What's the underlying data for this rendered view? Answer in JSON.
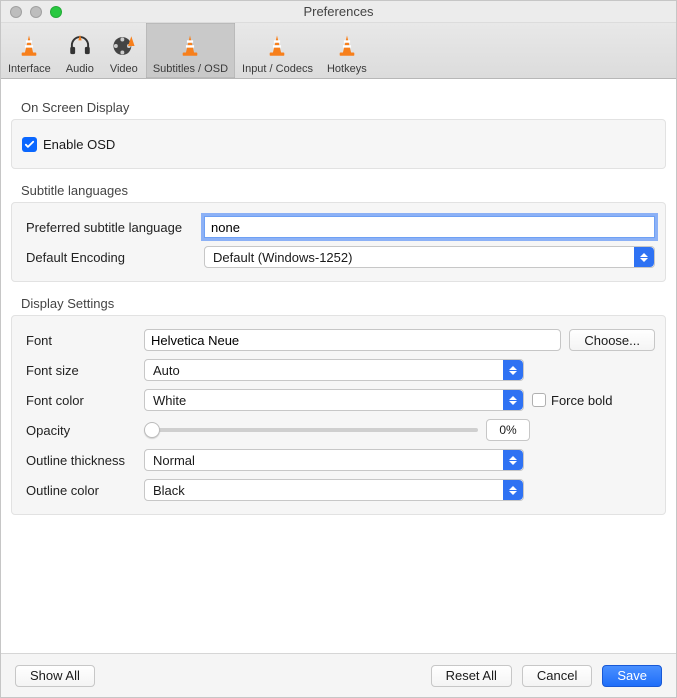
{
  "window": {
    "title": "Preferences"
  },
  "tabs": {
    "interface": "Interface",
    "audio": "Audio",
    "video": "Video",
    "subtitles": "Subtitles / OSD",
    "input": "Input / Codecs",
    "hotkeys": "Hotkeys",
    "active": "subtitles"
  },
  "sections": {
    "osd": {
      "title": "On Screen Display",
      "enable_label": "Enable OSD",
      "enable_checked": true
    },
    "lang": {
      "title": "Subtitle languages",
      "pref_label": "Preferred subtitle language",
      "pref_value": "none",
      "enc_label": "Default Encoding",
      "enc_value": "Default (Windows-1252)"
    },
    "display": {
      "title": "Display Settings",
      "font_label": "Font",
      "font_value": "Helvetica Neue",
      "choose_label": "Choose...",
      "size_label": "Font size",
      "size_value": "Auto",
      "color_label": "Font color",
      "color_value": "White",
      "forcebold_label": "Force bold",
      "forcebold_checked": false,
      "opacity_label": "Opacity",
      "opacity_value": "0%",
      "outline_thick_label": "Outline thickness",
      "outline_thick_value": "Normal",
      "outline_color_label": "Outline color",
      "outline_color_value": "Black"
    }
  },
  "footer": {
    "show_all": "Show All",
    "reset": "Reset All",
    "cancel": "Cancel",
    "save": "Save"
  }
}
